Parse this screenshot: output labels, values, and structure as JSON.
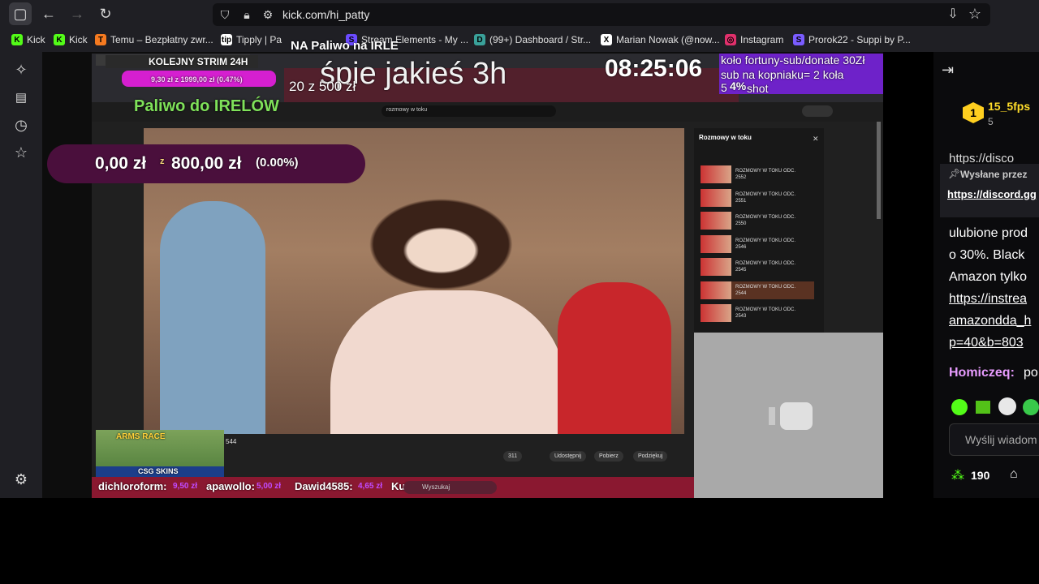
{
  "browser": {
    "url": "kick.com/hi_patty",
    "bookmarks": [
      {
        "label": "Kick",
        "color": "#53fc18",
        "glyph": "K"
      },
      {
        "label": "Kick",
        "color": "#53fc18",
        "glyph": "K"
      },
      {
        "label": "Temu – Bezpłatny zwr...",
        "color": "#f57a20",
        "glyph": "T"
      },
      {
        "label": "Tipply | Pa",
        "color": "#ffffff",
        "glyph": "tip"
      },
      {
        "label": "Stream Elements - My ...",
        "color": "#6b4bff",
        "glyph": "S"
      },
      {
        "label": "(99+) Dashboard / Str...",
        "color": "#3aa19a",
        "glyph": "D"
      },
      {
        "label": "Marian Nowak (@now...",
        "color": "#ffffff",
        "glyph": "X"
      },
      {
        "label": "Instagram",
        "color": "#e1306c",
        "glyph": "◎"
      },
      {
        "label": "Prorok22 - Suppi by P...",
        "color": "#7a5cff",
        "glyph": "S"
      }
    ]
  },
  "overlay": {
    "top_left_label": "KOLEJNY STRIM 24H",
    "top_goal_title": "NA Paliwo na IRLE",
    "sleep_text": "śpie jakieś 3h",
    "goal_small": "20 z 500 zł",
    "clock": "08:25:06",
    "wheel_text_1": "koło fortuny-sub/donate 30Zł",
    "wheel_text_2": "sub na kopniaku= 2 koła",
    "wheel_text_3": "5",
    "wheel_percent": "4%",
    "wheel_shot": "shot",
    "mini_goal": "9,30 zł z 1999,00 zł (0.47%)",
    "fuel_title": "Paliwo do IRELÓW",
    "goal_current": "0,00 zł",
    "goal_z": "z",
    "goal_target": "800,00 zł",
    "goal_percent": "(0.00%)",
    "arms_race": "ARMS RACE",
    "csg_skins": "CSG SKINS",
    "ticker": [
      {
        "name": "dichloroform:",
        "amount": "9,50 zł"
      },
      {
        "name": "apawollo:",
        "amount": "5,00 zł"
      },
      {
        "name": "Dawid4585:",
        "amount": "4,65 zł"
      },
      {
        "name": "Kul",
        "amount": ""
      }
    ],
    "search_placeholder": "Wyszukaj",
    "yt_search": "rozmowy w toku",
    "playlist_title": "Rozmowy w toku",
    "playlist_items": [
      "2552",
      "2551",
      "2550",
      "2546",
      "2545",
      "2544",
      "2543"
    ],
    "playlist_item_prefix": "ROZMOWY W TOKU ODC.",
    "video_actions": [
      "311",
      "Udostępnij",
      "Pobierz",
      "Podziękuj"
    ],
    "count_544": "544"
  },
  "chat": {
    "user_name": "15_5fps",
    "user_badge_num": "1",
    "user_count": "5",
    "pinned_label": "Wysłane przez",
    "pinned_link": "https://discord.gg",
    "discord_partial": "https://disco",
    "msg_lines": [
      "ulubione prod",
      "o 30%. Black",
      "Amazon tylko"
    ],
    "msg_links": [
      "https://instrea",
      "amazondda_h",
      "p=40&b=803"
    ],
    "user2": "Homiczeq:",
    "user2_msg": " po",
    "input_placeholder": "Wyślij wiadom",
    "points": "190"
  },
  "colors": {
    "kick_green": "#53fc18",
    "purple": "#7b2fe0",
    "goal_bg": "#4a0f3c"
  }
}
